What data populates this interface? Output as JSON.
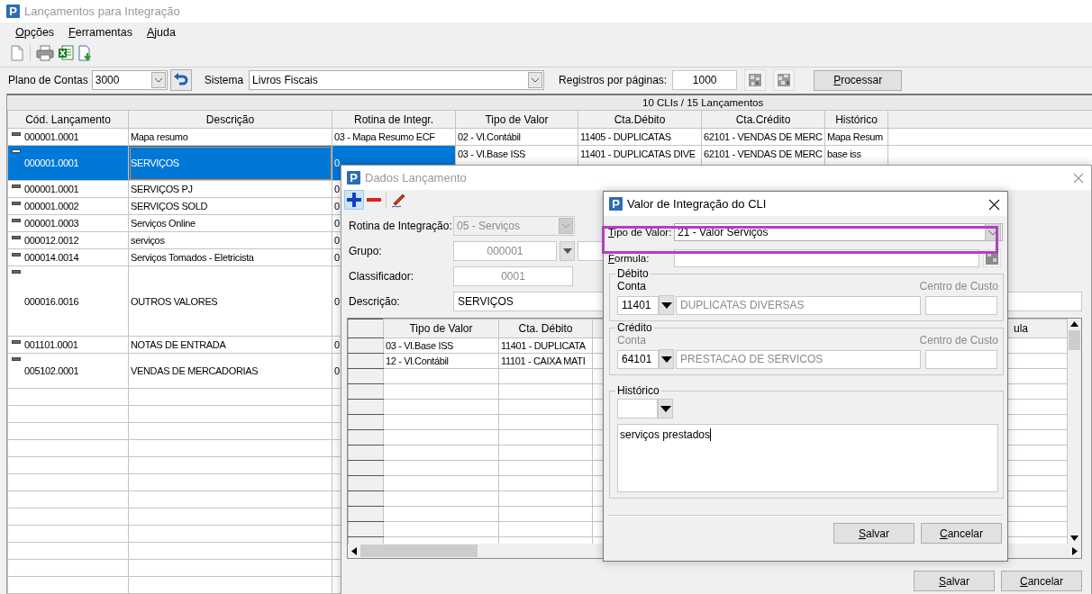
{
  "window": {
    "logo": "P",
    "title": "Lançamentos para Integração"
  },
  "menu": [
    {
      "label": "Opções"
    },
    {
      "label": "Ferramentas"
    },
    {
      "label": "Ajuda"
    }
  ],
  "filters": {
    "plano_label": "Plano de Contas",
    "plano_value": "3000",
    "sistema_label": "Sistema",
    "sistema_value": "Livros Fiscais",
    "registros_label": "Registros por páginas:",
    "registros_value": "1000",
    "process_button": {
      "label": "Processar"
    }
  },
  "summary": "10 CLIs / 15 Lançamentos",
  "table": {
    "columns": [
      "Cód. Lançamento",
      "Descrição",
      "Rotina de Integr.",
      "Tipo de Valor",
      "Cta.Débito",
      "Cta.Crédito",
      "Histórico"
    ],
    "rows": [
      {
        "kind": "single",
        "selected": false,
        "code": "000001.0001",
        "description": "Mapa resumo",
        "rotina": "03 - Mapa Resumo ECF",
        "tipo_valor": "02 - Vl.Contábil",
        "cta_debito": "11405 - DUPLICATAS",
        "cta_credito": "62101 - VENDAS DE MERC",
        "historico": "Mapa Resum"
      },
      {
        "kind": "double",
        "selected": true,
        "code": "000001.0001",
        "description": "SERVIÇOS",
        "rotina": "0",
        "tipo_valor": "03 - Vl.Base ISS",
        "cta_debito": "11401 - DUPLICATAS DIVE",
        "cta_credito": "62101 - VENDAS DE MERC",
        "historico": "base iss"
      },
      {
        "kind": "single",
        "selected": false,
        "code": "000001.0001",
        "description": "SERVIÇOS PJ",
        "rotina": "0"
      },
      {
        "kind": "single",
        "selected": false,
        "code": "000001.0002",
        "description": "SERVIÇOS SOLD",
        "rotina": "0"
      },
      {
        "kind": "single",
        "selected": false,
        "code": "000001.0003",
        "description": "Serviços Online",
        "rotina": "0"
      },
      {
        "kind": "single",
        "selected": false,
        "code": "000012.0012",
        "description": "serviços",
        "rotina": "0"
      },
      {
        "kind": "single",
        "selected": false,
        "code": "000014.0014",
        "description": "Serviços Tomados - Eletricista",
        "rotina": "0"
      },
      {
        "kind": "quad",
        "selected": false,
        "code": "000016.0016",
        "description": "OUTROS VALORES",
        "rotina": "0"
      },
      {
        "kind": "single",
        "selected": false,
        "code": "001101.0001",
        "description": "NOTAS DE ENTRADA",
        "rotina": "0"
      },
      {
        "kind": "double",
        "selected": false,
        "code": "005102.0001",
        "description": "VENDAS DE MERCADORIAS",
        "rotina": "0"
      }
    ]
  },
  "dados": {
    "logo": "P",
    "title": "Dados Lançamento",
    "rotina_label": "Rotina de Integração:",
    "rotina_value": "05 - Serviços",
    "grupo_label": "Grupo:",
    "grupo_value": "000001",
    "classificador_label": "Classificador:",
    "classificador_value": "0001",
    "descricao_label": "Descrição:",
    "descricao_value": "SERVIÇOS",
    "grid": {
      "columns": [
        "Tipo de Valor",
        "Cta. Débito"
      ],
      "column_5": "ula",
      "rows": [
        [
          "03 - Vl.Base ISS",
          "11401 - DUPLICATA"
        ],
        [
          "12 - Vl.Contábil",
          "11101 - CAIXA MATI"
        ]
      ]
    },
    "buttons": [
      {
        "label": "Salvar"
      },
      {
        "label": "Cancelar"
      }
    ]
  },
  "valor": {
    "logo": "P",
    "title": "Valor de Integração do CLI",
    "tipo_label": {
      "label": "Tipo de Valor:"
    },
    "tipo_value": "21 - Valor Serviços",
    "highlighted": true,
    "formula_label": {
      "label": "Formula:"
    },
    "groups": [
      {
        "legend": "Débito",
        "conta_label": "Conta",
        "conta_disabled": false,
        "conta": "11401",
        "conta_name": "DUPLICATAS DIVERSAS",
        "centro_label": "Centro de Custo"
      },
      {
        "legend": "Crédito",
        "conta_label": "Conta",
        "conta_disabled": true,
        "conta": "64101",
        "conta_name": "PRESTACAO DE SERVICOS",
        "centro_label": "Centro de Custo"
      }
    ],
    "historico": {
      "legend": "Histórico",
      "text": "serviços prestados"
    },
    "buttons": [
      {
        "label": "Salvar"
      },
      {
        "label": "Cancelar"
      }
    ]
  }
}
